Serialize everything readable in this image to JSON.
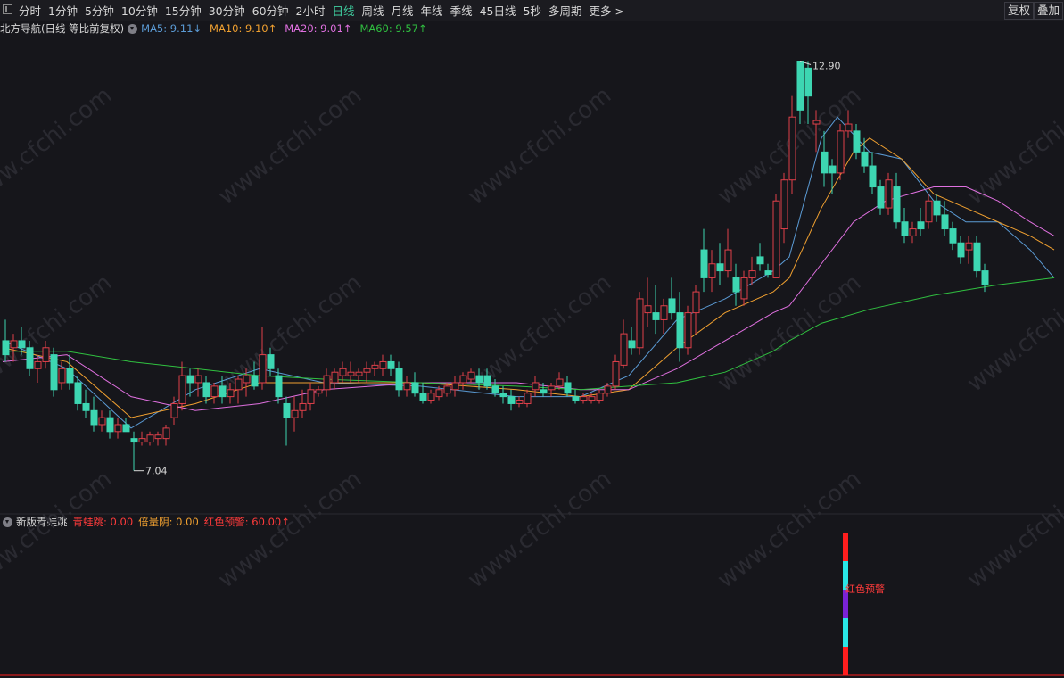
{
  "toolbar": {
    "tabs": [
      "分时",
      "1分钟",
      "5分钟",
      "10分钟",
      "15分钟",
      "30分钟",
      "60分钟",
      "2小时",
      "日线",
      "周线",
      "月线",
      "年线",
      "季线",
      "45日线",
      "5秒",
      "多周期",
      "更多 >"
    ],
    "active_tab": "日线",
    "right_buttons": [
      "复权",
      "叠加"
    ]
  },
  "main_legend": {
    "title": "北方导航(日线 等比前复权)",
    "ma5": {
      "label": "MA5: 9.11↓",
      "color": "#5b9bd5"
    },
    "ma10": {
      "label": "MA10: 9.10↑",
      "color": "#f0a030"
    },
    "ma20": {
      "label": "MA20: 9.01↑",
      "color": "#e070e0"
    },
    "ma60": {
      "label": "MA60: 9.57↑",
      "color": "#30c040"
    }
  },
  "price_annotations": {
    "high": "12.90",
    "low": "7.04"
  },
  "sub_legend": {
    "title": "新版青蛙跳",
    "items": [
      {
        "label": "青蛙跳: 0.00",
        "color": "#ff3b3b"
      },
      {
        "label": "倍量阴: 0.00",
        "color": "#f0a030"
      },
      {
        "label": "红色预警: 60.00↑",
        "color": "#ff3b3b"
      }
    ],
    "signal_label": "红色预警"
  },
  "colors": {
    "up": "#e0404a",
    "down": "#3dd6b2",
    "background": "#16161b"
  },
  "chart_data": {
    "type": "candlestick",
    "y_range": [
      6.5,
      13.2
    ],
    "candles": [
      {
        "o": 8.9,
        "h": 9.2,
        "l": 8.6,
        "c": 8.7
      },
      {
        "o": 8.8,
        "h": 9.0,
        "l": 8.6,
        "c": 8.9
      },
      {
        "o": 8.9,
        "h": 9.1,
        "l": 8.7,
        "c": 8.8
      },
      {
        "o": 8.8,
        "h": 8.9,
        "l": 8.4,
        "c": 8.5
      },
      {
        "o": 8.5,
        "h": 8.7,
        "l": 8.3,
        "c": 8.6
      },
      {
        "o": 8.6,
        "h": 8.9,
        "l": 8.5,
        "c": 8.8
      },
      {
        "o": 8.7,
        "h": 8.8,
        "l": 8.1,
        "c": 8.2
      },
      {
        "o": 8.3,
        "h": 8.6,
        "l": 8.2,
        "c": 8.5
      },
      {
        "o": 8.5,
        "h": 8.7,
        "l": 8.2,
        "c": 8.3
      },
      {
        "o": 8.3,
        "h": 8.4,
        "l": 7.9,
        "c": 8.0
      },
      {
        "o": 8.0,
        "h": 8.2,
        "l": 7.8,
        "c": 7.9
      },
      {
        "o": 7.9,
        "h": 8.1,
        "l": 7.6,
        "c": 7.7
      },
      {
        "o": 7.7,
        "h": 7.9,
        "l": 7.6,
        "c": 7.8
      },
      {
        "o": 7.8,
        "h": 7.9,
        "l": 7.5,
        "c": 7.6
      },
      {
        "o": 7.6,
        "h": 7.8,
        "l": 7.5,
        "c": 7.7
      },
      {
        "o": 7.7,
        "h": 7.8,
        "l": 7.6,
        "c": 7.6
      },
      {
        "o": 7.5,
        "h": 7.6,
        "l": 7.04,
        "c": 7.45
      },
      {
        "o": 7.45,
        "h": 7.6,
        "l": 7.4,
        "c": 7.5
      },
      {
        "o": 7.45,
        "h": 7.6,
        "l": 7.4,
        "c": 7.55
      },
      {
        "o": 7.5,
        "h": 7.6,
        "l": 7.4,
        "c": 7.55
      },
      {
        "o": 7.5,
        "h": 7.7,
        "l": 7.4,
        "c": 7.65
      },
      {
        "o": 7.8,
        "h": 8.1,
        "l": 7.7,
        "c": 8.0
      },
      {
        "o": 8.0,
        "h": 8.6,
        "l": 7.9,
        "c": 8.4
      },
      {
        "o": 8.4,
        "h": 8.5,
        "l": 8.1,
        "c": 8.3
      },
      {
        "o": 8.3,
        "h": 8.5,
        "l": 8.1,
        "c": 8.4
      },
      {
        "o": 8.3,
        "h": 8.4,
        "l": 8.0,
        "c": 8.1
      },
      {
        "o": 8.1,
        "h": 8.3,
        "l": 8.0,
        "c": 8.25
      },
      {
        "o": 8.25,
        "h": 8.4,
        "l": 8.0,
        "c": 8.1
      },
      {
        "o": 8.1,
        "h": 8.3,
        "l": 8.0,
        "c": 8.2
      },
      {
        "o": 8.2,
        "h": 8.4,
        "l": 8.0,
        "c": 8.35
      },
      {
        "o": 8.3,
        "h": 8.5,
        "l": 8.1,
        "c": 8.4
      },
      {
        "o": 8.4,
        "h": 8.6,
        "l": 8.2,
        "c": 8.25
      },
      {
        "o": 8.3,
        "h": 9.1,
        "l": 8.2,
        "c": 8.7
      },
      {
        "o": 8.7,
        "h": 8.8,
        "l": 8.4,
        "c": 8.5
      },
      {
        "o": 8.4,
        "h": 8.5,
        "l": 8.0,
        "c": 8.1
      },
      {
        "o": 8.0,
        "h": 8.1,
        "l": 7.4,
        "c": 7.8
      },
      {
        "o": 7.8,
        "h": 8.1,
        "l": 7.6,
        "c": 7.9
      },
      {
        "o": 7.9,
        "h": 8.2,
        "l": 7.8,
        "c": 8.0
      },
      {
        "o": 8.0,
        "h": 8.3,
        "l": 7.9,
        "c": 8.2
      },
      {
        "o": 8.15,
        "h": 8.25,
        "l": 8.1,
        "c": 8.2
      },
      {
        "o": 8.2,
        "h": 8.5,
        "l": 8.1,
        "c": 8.4
      },
      {
        "o": 8.3,
        "h": 8.5,
        "l": 8.2,
        "c": 8.45
      },
      {
        "o": 8.4,
        "h": 8.6,
        "l": 8.3,
        "c": 8.5
      },
      {
        "o": 8.4,
        "h": 8.6,
        "l": 8.3,
        "c": 8.45
      },
      {
        "o": 8.4,
        "h": 8.5,
        "l": 8.3,
        "c": 8.45
      },
      {
        "o": 8.45,
        "h": 8.6,
        "l": 8.3,
        "c": 8.5
      },
      {
        "o": 8.5,
        "h": 8.6,
        "l": 8.4,
        "c": 8.55
      },
      {
        "o": 8.5,
        "h": 8.7,
        "l": 8.4,
        "c": 8.6
      },
      {
        "o": 8.6,
        "h": 8.7,
        "l": 8.4,
        "c": 8.5
      },
      {
        "o": 8.5,
        "h": 8.6,
        "l": 8.1,
        "c": 8.2
      },
      {
        "o": 8.2,
        "h": 8.4,
        "l": 8.1,
        "c": 8.3
      },
      {
        "o": 8.3,
        "h": 8.45,
        "l": 8.1,
        "c": 8.15
      },
      {
        "o": 8.15,
        "h": 8.3,
        "l": 8.0,
        "c": 8.05
      },
      {
        "o": 8.05,
        "h": 8.2,
        "l": 8.0,
        "c": 8.15
      },
      {
        "o": 8.1,
        "h": 8.25,
        "l": 8.05,
        "c": 8.2
      },
      {
        "o": 8.15,
        "h": 8.3,
        "l": 8.1,
        "c": 8.25
      },
      {
        "o": 8.2,
        "h": 8.4,
        "l": 8.1,
        "c": 8.3
      },
      {
        "o": 8.3,
        "h": 8.45,
        "l": 8.2,
        "c": 8.4
      },
      {
        "o": 8.35,
        "h": 8.5,
        "l": 8.3,
        "c": 8.45
      },
      {
        "o": 8.4,
        "h": 8.5,
        "l": 8.2,
        "c": 8.3
      },
      {
        "o": 8.4,
        "h": 8.5,
        "l": 8.2,
        "c": 8.25
      },
      {
        "o": 8.25,
        "h": 8.35,
        "l": 8.1,
        "c": 8.15
      },
      {
        "o": 8.15,
        "h": 8.25,
        "l": 8.0,
        "c": 8.1
      },
      {
        "o": 8.1,
        "h": 8.2,
        "l": 7.9,
        "c": 8.0
      },
      {
        "o": 8.0,
        "h": 8.1,
        "l": 7.95,
        "c": 8.05
      },
      {
        "o": 8.0,
        "h": 8.2,
        "l": 7.95,
        "c": 8.15
      },
      {
        "o": 8.2,
        "h": 8.4,
        "l": 8.1,
        "c": 8.3
      },
      {
        "o": 8.2,
        "h": 8.3,
        "l": 8.1,
        "c": 8.15
      },
      {
        "o": 8.2,
        "h": 8.3,
        "l": 8.1,
        "c": 8.25
      },
      {
        "o": 8.25,
        "h": 8.45,
        "l": 8.2,
        "c": 8.35
      },
      {
        "o": 8.3,
        "h": 8.4,
        "l": 8.1,
        "c": 8.15
      },
      {
        "o": 8.1,
        "h": 8.2,
        "l": 8.0,
        "c": 8.05
      },
      {
        "o": 8.05,
        "h": 8.15,
        "l": 8.0,
        "c": 8.1
      },
      {
        "o": 8.05,
        "h": 8.15,
        "l": 8.0,
        "c": 8.1
      },
      {
        "o": 8.05,
        "h": 8.2,
        "l": 8.0,
        "c": 8.15
      },
      {
        "o": 8.15,
        "h": 8.3,
        "l": 8.1,
        "c": 8.25
      },
      {
        "o": 8.25,
        "h": 8.7,
        "l": 8.2,
        "c": 8.6
      },
      {
        "o": 8.55,
        "h": 9.2,
        "l": 8.5,
        "c": 9.0
      },
      {
        "o": 8.9,
        "h": 9.1,
        "l": 8.7,
        "c": 8.8
      },
      {
        "o": 8.8,
        "h": 9.6,
        "l": 8.7,
        "c": 9.5
      },
      {
        "o": 9.3,
        "h": 9.8,
        "l": 9.1,
        "c": 9.4
      },
      {
        "o": 9.3,
        "h": 9.7,
        "l": 9.0,
        "c": 9.2
      },
      {
        "o": 9.2,
        "h": 9.5,
        "l": 9.0,
        "c": 9.4
      },
      {
        "o": 9.5,
        "h": 9.8,
        "l": 9.2,
        "c": 9.3
      },
      {
        "o": 9.3,
        "h": 9.6,
        "l": 8.6,
        "c": 8.8
      },
      {
        "o": 8.8,
        "h": 9.4,
        "l": 8.7,
        "c": 9.3
      },
      {
        "o": 9.3,
        "h": 9.7,
        "l": 9.0,
        "c": 9.6
      },
      {
        "o": 10.2,
        "h": 10.5,
        "l": 9.6,
        "c": 9.8
      },
      {
        "o": 9.8,
        "h": 10.2,
        "l": 9.6,
        "c": 10.0
      },
      {
        "o": 10.0,
        "h": 10.3,
        "l": 9.7,
        "c": 9.9
      },
      {
        "o": 9.9,
        "h": 10.5,
        "l": 9.8,
        "c": 10.2
      },
      {
        "o": 9.8,
        "h": 10.0,
        "l": 9.4,
        "c": 9.6
      },
      {
        "o": 9.5,
        "h": 9.9,
        "l": 9.4,
        "c": 9.8
      },
      {
        "o": 9.8,
        "h": 10.1,
        "l": 9.7,
        "c": 9.9
      },
      {
        "o": 10.1,
        "h": 10.3,
        "l": 9.9,
        "c": 10.0
      },
      {
        "o": 9.9,
        "h": 10.0,
        "l": 9.8,
        "c": 9.85
      },
      {
        "o": 9.8,
        "h": 11.0,
        "l": 9.8,
        "c": 10.9
      },
      {
        "o": 10.5,
        "h": 11.3,
        "l": 10.3,
        "c": 11.2
      },
      {
        "o": 11.2,
        "h": 12.4,
        "l": 11.0,
        "c": 12.1
      },
      {
        "o": 12.9,
        "h": 12.9,
        "l": 12.0,
        "c": 12.2
      },
      {
        "o": 12.8,
        "h": 12.9,
        "l": 12.0,
        "c": 12.4
      },
      {
        "o": 12.0,
        "h": 12.2,
        "l": 11.6,
        "c": 12.05
      },
      {
        "o": 11.6,
        "h": 11.9,
        "l": 11.1,
        "c": 11.3
      },
      {
        "o": 11.4,
        "h": 11.5,
        "l": 11.0,
        "c": 11.3
      },
      {
        "o": 11.3,
        "h": 12.0,
        "l": 11.2,
        "c": 11.9
      },
      {
        "o": 11.9,
        "h": 12.2,
        "l": 11.8,
        "c": 12.0
      },
      {
        "o": 11.9,
        "h": 12.0,
        "l": 11.5,
        "c": 11.6
      },
      {
        "o": 11.6,
        "h": 11.8,
        "l": 11.3,
        "c": 11.4
      },
      {
        "o": 11.4,
        "h": 11.6,
        "l": 11.0,
        "c": 11.1
      },
      {
        "o": 11.1,
        "h": 11.2,
        "l": 10.7,
        "c": 10.8
      },
      {
        "o": 10.8,
        "h": 11.3,
        "l": 10.7,
        "c": 11.2
      },
      {
        "o": 11.1,
        "h": 11.3,
        "l": 10.5,
        "c": 10.6
      },
      {
        "o": 10.6,
        "h": 10.8,
        "l": 10.3,
        "c": 10.4
      },
      {
        "o": 10.4,
        "h": 10.6,
        "l": 10.3,
        "c": 10.5
      },
      {
        "o": 10.6,
        "h": 10.8,
        "l": 10.4,
        "c": 10.5
      },
      {
        "o": 10.6,
        "h": 11.0,
        "l": 10.5,
        "c": 10.9
      },
      {
        "o": 10.9,
        "h": 11.0,
        "l": 10.6,
        "c": 10.7
      },
      {
        "o": 10.7,
        "h": 10.9,
        "l": 10.4,
        "c": 10.5
      },
      {
        "o": 10.5,
        "h": 10.6,
        "l": 10.2,
        "c": 10.3
      },
      {
        "o": 10.3,
        "h": 10.4,
        "l": 10.0,
        "c": 10.1
      },
      {
        "o": 10.2,
        "h": 10.4,
        "l": 10.0,
        "c": 10.3
      },
      {
        "o": 10.3,
        "h": 10.4,
        "l": 9.8,
        "c": 9.9
      },
      {
        "o": 9.9,
        "h": 10.0,
        "l": 9.6,
        "c": 9.7
      }
    ],
    "ma": {
      "ma5": [
        [
          0,
          8.9
        ],
        [
          8,
          8.5
        ],
        [
          16,
          7.65
        ],
        [
          24,
          8.2
        ],
        [
          32,
          8.5
        ],
        [
          40,
          8.3
        ],
        [
          52,
          8.25
        ],
        [
          64,
          8.1
        ],
        [
          72,
          8.1
        ],
        [
          78,
          8.4
        ],
        [
          84,
          9.2
        ],
        [
          90,
          9.5
        ],
        [
          96,
          9.9
        ],
        [
          98,
          10.1
        ],
        [
          102,
          11.8
        ],
        [
          104,
          12.1
        ],
        [
          108,
          11.6
        ],
        [
          112,
          11.5
        ],
        [
          116,
          10.9
        ],
        [
          120,
          10.6
        ],
        [
          124,
          10.6
        ],
        [
          128,
          10.2
        ],
        [
          131,
          9.8
        ]
      ],
      "ma10": [
        [
          0,
          8.8
        ],
        [
          8,
          8.6
        ],
        [
          16,
          7.8
        ],
        [
          24,
          8.0
        ],
        [
          32,
          8.3
        ],
        [
          40,
          8.3
        ],
        [
          52,
          8.3
        ],
        [
          64,
          8.2
        ],
        [
          72,
          8.1
        ],
        [
          78,
          8.2
        ],
        [
          84,
          8.8
        ],
        [
          90,
          9.3
        ],
        [
          96,
          9.6
        ],
        [
          98,
          9.8
        ],
        [
          102,
          10.8
        ],
        [
          106,
          11.6
        ],
        [
          108,
          11.8
        ],
        [
          112,
          11.5
        ],
        [
          116,
          11.0
        ],
        [
          120,
          10.8
        ],
        [
          124,
          10.6
        ],
        [
          128,
          10.4
        ],
        [
          131,
          10.2
        ]
      ],
      "ma20": [
        [
          0,
          8.6
        ],
        [
          8,
          8.7
        ],
        [
          16,
          8.1
        ],
        [
          24,
          7.9
        ],
        [
          32,
          8.0
        ],
        [
          40,
          8.2
        ],
        [
          52,
          8.3
        ],
        [
          64,
          8.3
        ],
        [
          72,
          8.2
        ],
        [
          78,
          8.2
        ],
        [
          84,
          8.5
        ],
        [
          90,
          8.9
        ],
        [
          96,
          9.3
        ],
        [
          98,
          9.4
        ],
        [
          102,
          10.0
        ],
        [
          106,
          10.6
        ],
        [
          110,
          10.9
        ],
        [
          116,
          11.1
        ],
        [
          120,
          11.1
        ],
        [
          124,
          10.9
        ],
        [
          128,
          10.6
        ],
        [
          131,
          10.4
        ]
      ],
      "ma60": [
        [
          0,
          8.75
        ],
        [
          8,
          8.75
        ],
        [
          16,
          8.6
        ],
        [
          24,
          8.5
        ],
        [
          32,
          8.4
        ],
        [
          40,
          8.35
        ],
        [
          52,
          8.3
        ],
        [
          64,
          8.25
        ],
        [
          72,
          8.2
        ],
        [
          78,
          8.25
        ],
        [
          84,
          8.3
        ],
        [
          90,
          8.45
        ],
        [
          96,
          8.75
        ],
        [
          98,
          8.9
        ],
        [
          102,
          9.15
        ],
        [
          108,
          9.35
        ],
        [
          116,
          9.55
        ],
        [
          124,
          9.7
        ],
        [
          131,
          9.8
        ]
      ]
    },
    "signal_bars": [
      {
        "index": 105,
        "value": 60.0
      }
    ]
  }
}
